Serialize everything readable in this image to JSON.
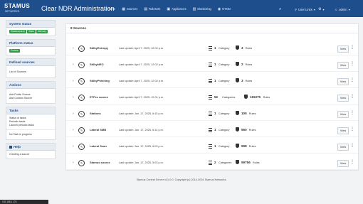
{
  "header": {
    "logo_text": "STAMUS",
    "logo_sub": "NETWORKS",
    "app_title": "Clear NDR Administration",
    "nav": [
      {
        "label": "Home",
        "icon": "home-icon",
        "glyph": "⌂"
      },
      {
        "label": "Sources",
        "icon": "sources-icon",
        "glyph": "▦"
      },
      {
        "label": "Rulesets",
        "icon": "rulesets-icon",
        "glyph": "▤"
      },
      {
        "label": "Appliances",
        "icon": "appliances-icon",
        "glyph": "▣"
      },
      {
        "label": "Monitoring",
        "icon": "monitoring-icon",
        "glyph": "▥"
      },
      {
        "label": "NTOD",
        "icon": "ntod-icon",
        "glyph": "◉"
      }
    ],
    "user_links": {
      "search_glyph": "⌕",
      "user": "User Links",
      "settings_glyph": "⚙",
      "account": "admin"
    }
  },
  "sidebar": {
    "system_status": {
      "title": "System status",
      "badges": [
        "Elasticsearch",
        "Stats",
        "Memory"
      ]
    },
    "platform_status": {
      "title": "Platform status",
      "badges": [
        "Probes"
      ]
    },
    "defined_sources": {
      "title": "Defined sources",
      "items": [
        "List of Sources"
      ]
    },
    "actions": {
      "title": "Actions",
      "items": [
        "Add Public Source",
        "Add Custom Source"
      ]
    },
    "tasks": {
      "title": "Tasks",
      "items": [
        "Status of tasks",
        "Periodic tasks",
        "Launch periodic tasks"
      ],
      "empty": "No Task in progress"
    },
    "help": {
      "title": "Help",
      "items": [
        "Creating a source"
      ]
    }
  },
  "main": {
    "heading": "8 Sources",
    "view_label": "View",
    "sources": [
      {
        "name": "StilbyEntropy",
        "updated": "Last update: April 7, 2025, 12:02 p.m.",
        "categories": "1",
        "cat_label": "Category",
        "rules": "3",
        "rules_label": "Rules"
      },
      {
        "name": "StilbyNEO",
        "updated": "Last update: April 7, 2025, 12:02 p.m.",
        "categories": "1",
        "cat_label": "Category",
        "rules": "2",
        "rules_label": "Rules"
      },
      {
        "name": "StilbyPhishing",
        "updated": "Last update: April 7, 2025, 12:02 p.m.",
        "categories": "1",
        "cat_label": "Category",
        "rules": "3",
        "rules_label": "Rules"
      },
      {
        "name": "ETPro source",
        "updated": "Last update: April 7, 2025, 12:01 p.m.",
        "categories": "52",
        "cat_label": "Categories",
        "rules": "115375",
        "rules_label": "Rules"
      },
      {
        "name": "Stations",
        "updated": "Last update: Jan. 17, 2025, 6:15 p.m.",
        "categories": "1",
        "cat_label": "Category",
        "rules": "105",
        "rules_label": "Rules"
      },
      {
        "name": "Lateral SMB",
        "updated": "Last update: Jan. 17, 2025, 6:14 p.m.",
        "categories": "1",
        "cat_label": "Category",
        "rules": "560",
        "rules_label": "Rules"
      },
      {
        "name": "Lateral Scan",
        "updated": "Last update: Jan. 17, 2025, 6:03 p.m.",
        "categories": "1",
        "cat_label": "Category",
        "rules": "598",
        "rules_label": "Rules"
      },
      {
        "name": "Stamus source",
        "updated": "Last update: Jan. 17, 2025, 5:03 p.m.",
        "categories": "2",
        "cat_label": "Categories",
        "rules": "59756",
        "rules_label": "Rules"
      }
    ]
  },
  "footer": {
    "text": "Stamus Central Server v41.0.0. Copyright (c) 2014-2024 Stamus Networks."
  },
  "statusbar": {
    "text": "192.168.1.176"
  },
  "colors": {
    "header": "#1f4e8c",
    "badge": "#2e9e44"
  }
}
